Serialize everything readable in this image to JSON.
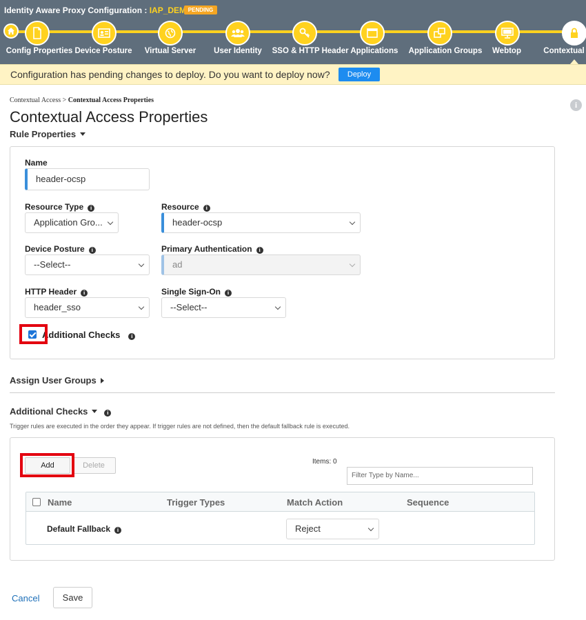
{
  "wizard": {
    "title_prefix": "Identity Aware Proxy Configuration : ",
    "config_name": "IAP_DEMO",
    "status_badge": "PENDING",
    "steps": [
      {
        "label": "Config Properties",
        "icon": "file-icon"
      },
      {
        "label": "Device Posture",
        "icon": "id-card-icon"
      },
      {
        "label": "Virtual Server",
        "icon": "globe-icon"
      },
      {
        "label": "User Identity",
        "icon": "users-icon"
      },
      {
        "label": "SSO & HTTP Header Applications",
        "icon": "key-icon"
      },
      {
        "label": "Application Groups",
        "icon": "window-icon"
      },
      {
        "label": "Webtop",
        "icon": "windows-icon"
      },
      {
        "label": "Contextual",
        "icon": "monitor-icon"
      }
    ]
  },
  "banner": {
    "message": "Configuration has pending changes to deploy. Do you want to deploy now?",
    "deploy_label": "Deploy"
  },
  "breadcrumb": {
    "parent": "Contextual Access",
    "separator": " > ",
    "current": "Contextual Access Properties"
  },
  "page_title": "Contextual Access Properties",
  "rule_properties": {
    "heading": "Rule Properties",
    "name_label": "Name",
    "name_value": "header-ocsp",
    "resource_type_label": "Resource Type",
    "resource_type_value": "Application Gro...",
    "resource_label": "Resource",
    "resource_value": "header-ocsp",
    "device_posture_label": "Device Posture",
    "device_posture_value": "--Select--",
    "primary_auth_label": "Primary Authentication",
    "primary_auth_value": "ad",
    "http_header_label": "HTTP Header",
    "http_header_value": "header_sso",
    "sso_label": "Single Sign-On",
    "sso_value": "--Select--",
    "additional_checks_label": "Additional Checks",
    "additional_checks_checked": true
  },
  "assign_user_groups": {
    "heading": "Assign User Groups"
  },
  "additional_checks": {
    "heading": "Additional Checks",
    "description": "Trigger rules are executed in the order they appear. If trigger rules are not defined, then the default fallback rule is executed.",
    "add_label": "Add",
    "delete_label": "Delete",
    "items_count": "Items: 0",
    "filter_placeholder": "Filter Type by Name...",
    "columns": [
      "Name",
      "Trigger Types",
      "Match Action",
      "Sequence"
    ],
    "rows": [
      {
        "name": "Default Fallback",
        "match_action": "Reject"
      }
    ]
  },
  "footer": {
    "cancel_label": "Cancel",
    "save_label": "Save"
  },
  "colors": {
    "header_bg": "#5f6e7c",
    "accent_yellow": "#ffd21f",
    "deploy_blue": "#1d8cf0",
    "highlight_red": "#e3000f"
  }
}
